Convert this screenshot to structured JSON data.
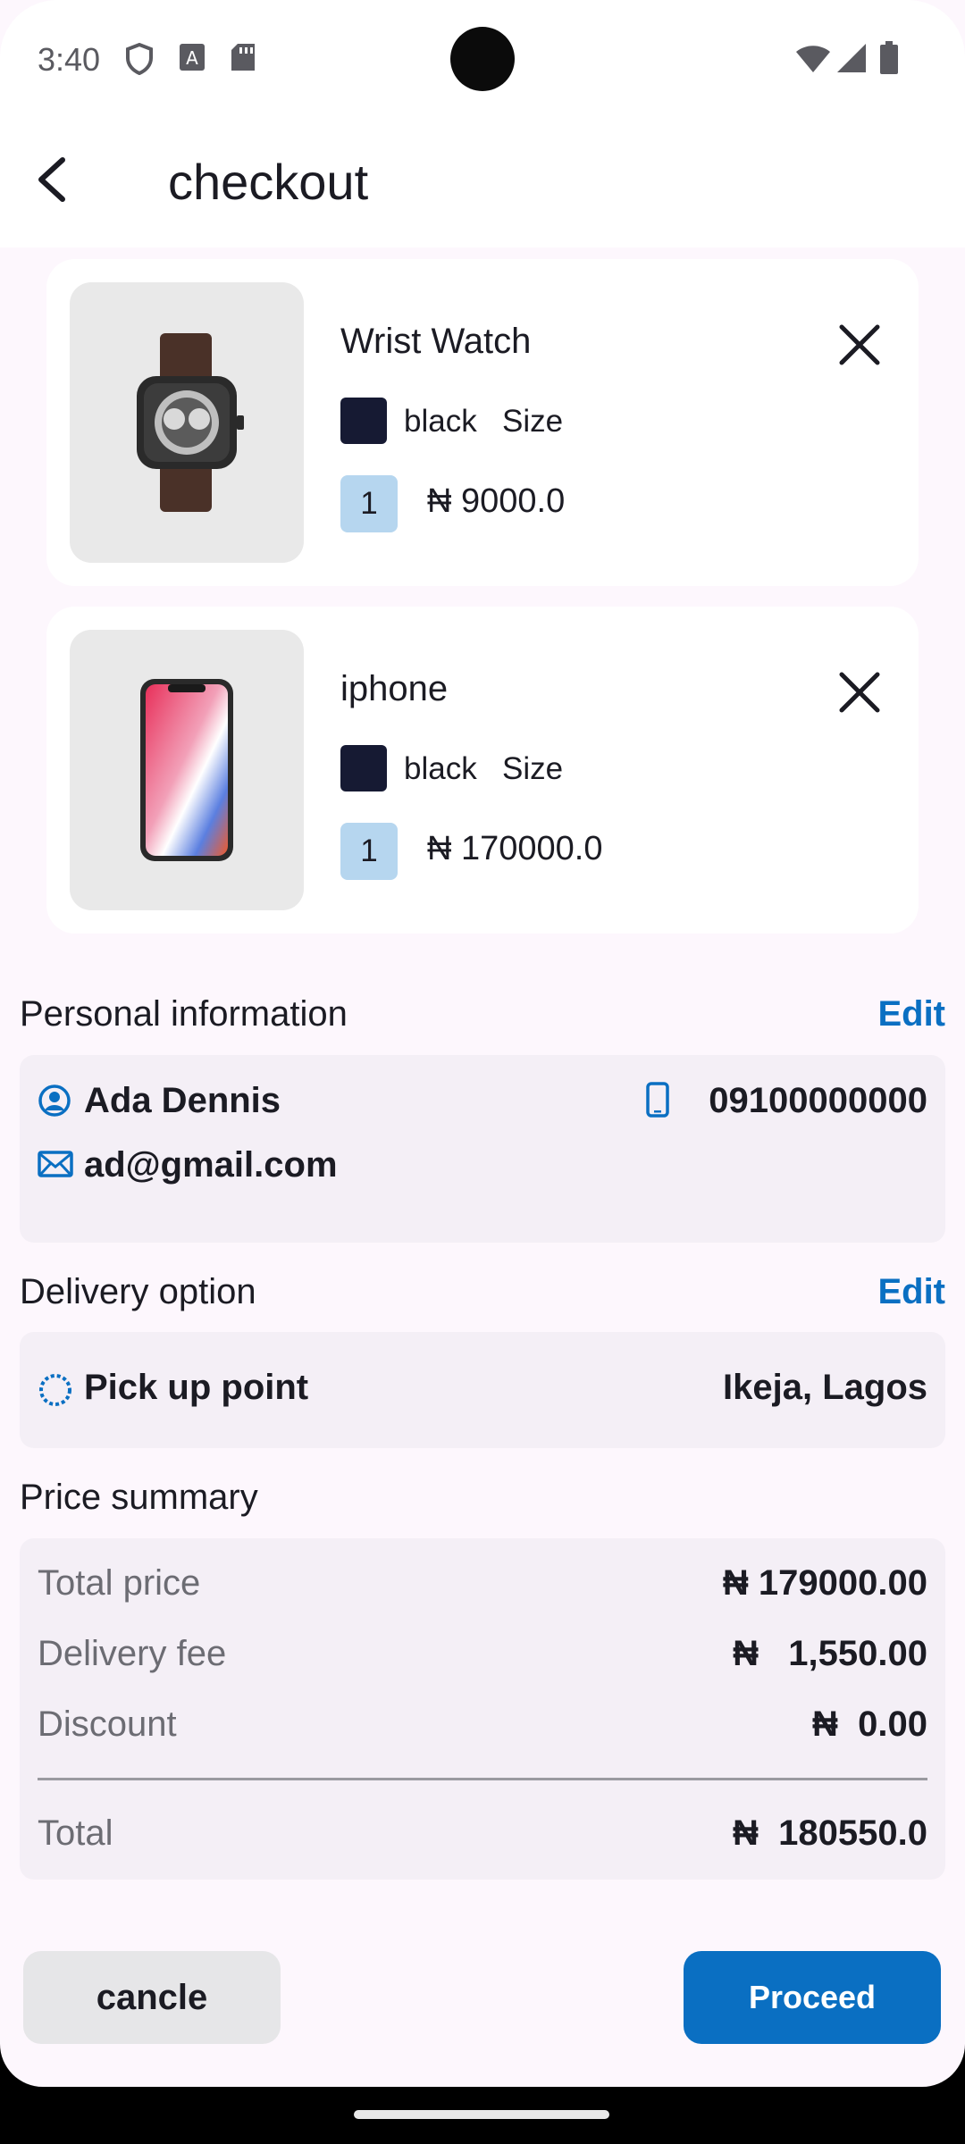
{
  "status_bar": {
    "time": "3:40"
  },
  "app_bar": {
    "title": "checkout"
  },
  "cart": {
    "items": [
      {
        "name": "Wrist Watch",
        "color": "black",
        "size_label": "Size",
        "quantity": "1",
        "price": "₦ 9000.0",
        "image": "wrist-watch"
      },
      {
        "name": "iphone",
        "color": "black",
        "size_label": "Size",
        "quantity": "1",
        "price": "₦ 170000.0",
        "image": "iphone"
      }
    ]
  },
  "personal_info": {
    "title": "Personal information",
    "edit": "Edit",
    "name": "Ada Dennis",
    "phone": "09100000000",
    "email": "ad@gmail.com"
  },
  "delivery": {
    "title": "Delivery option",
    "edit": "Edit",
    "option": "Pick up point",
    "location": "Ikeja, Lagos"
  },
  "price_summary": {
    "title": "Price summary",
    "rows": [
      {
        "label": "Total price",
        "value": "₦ 179000.00"
      },
      {
        "label": "Delivery fee",
        "value": "₦   1,550.00"
      },
      {
        "label": "Discount",
        "value": "₦  0.00"
      }
    ],
    "total_label": "Total",
    "total_value": "₦  180550.0"
  },
  "actions": {
    "cancel": "cancle",
    "proceed": "Proceed"
  },
  "colors": {
    "accent": "#0a6fc2",
    "swatch": "#161a33",
    "qty_badge": "#b6d6ef",
    "background": "#fdf7fd",
    "panel": "#f4eff6"
  }
}
